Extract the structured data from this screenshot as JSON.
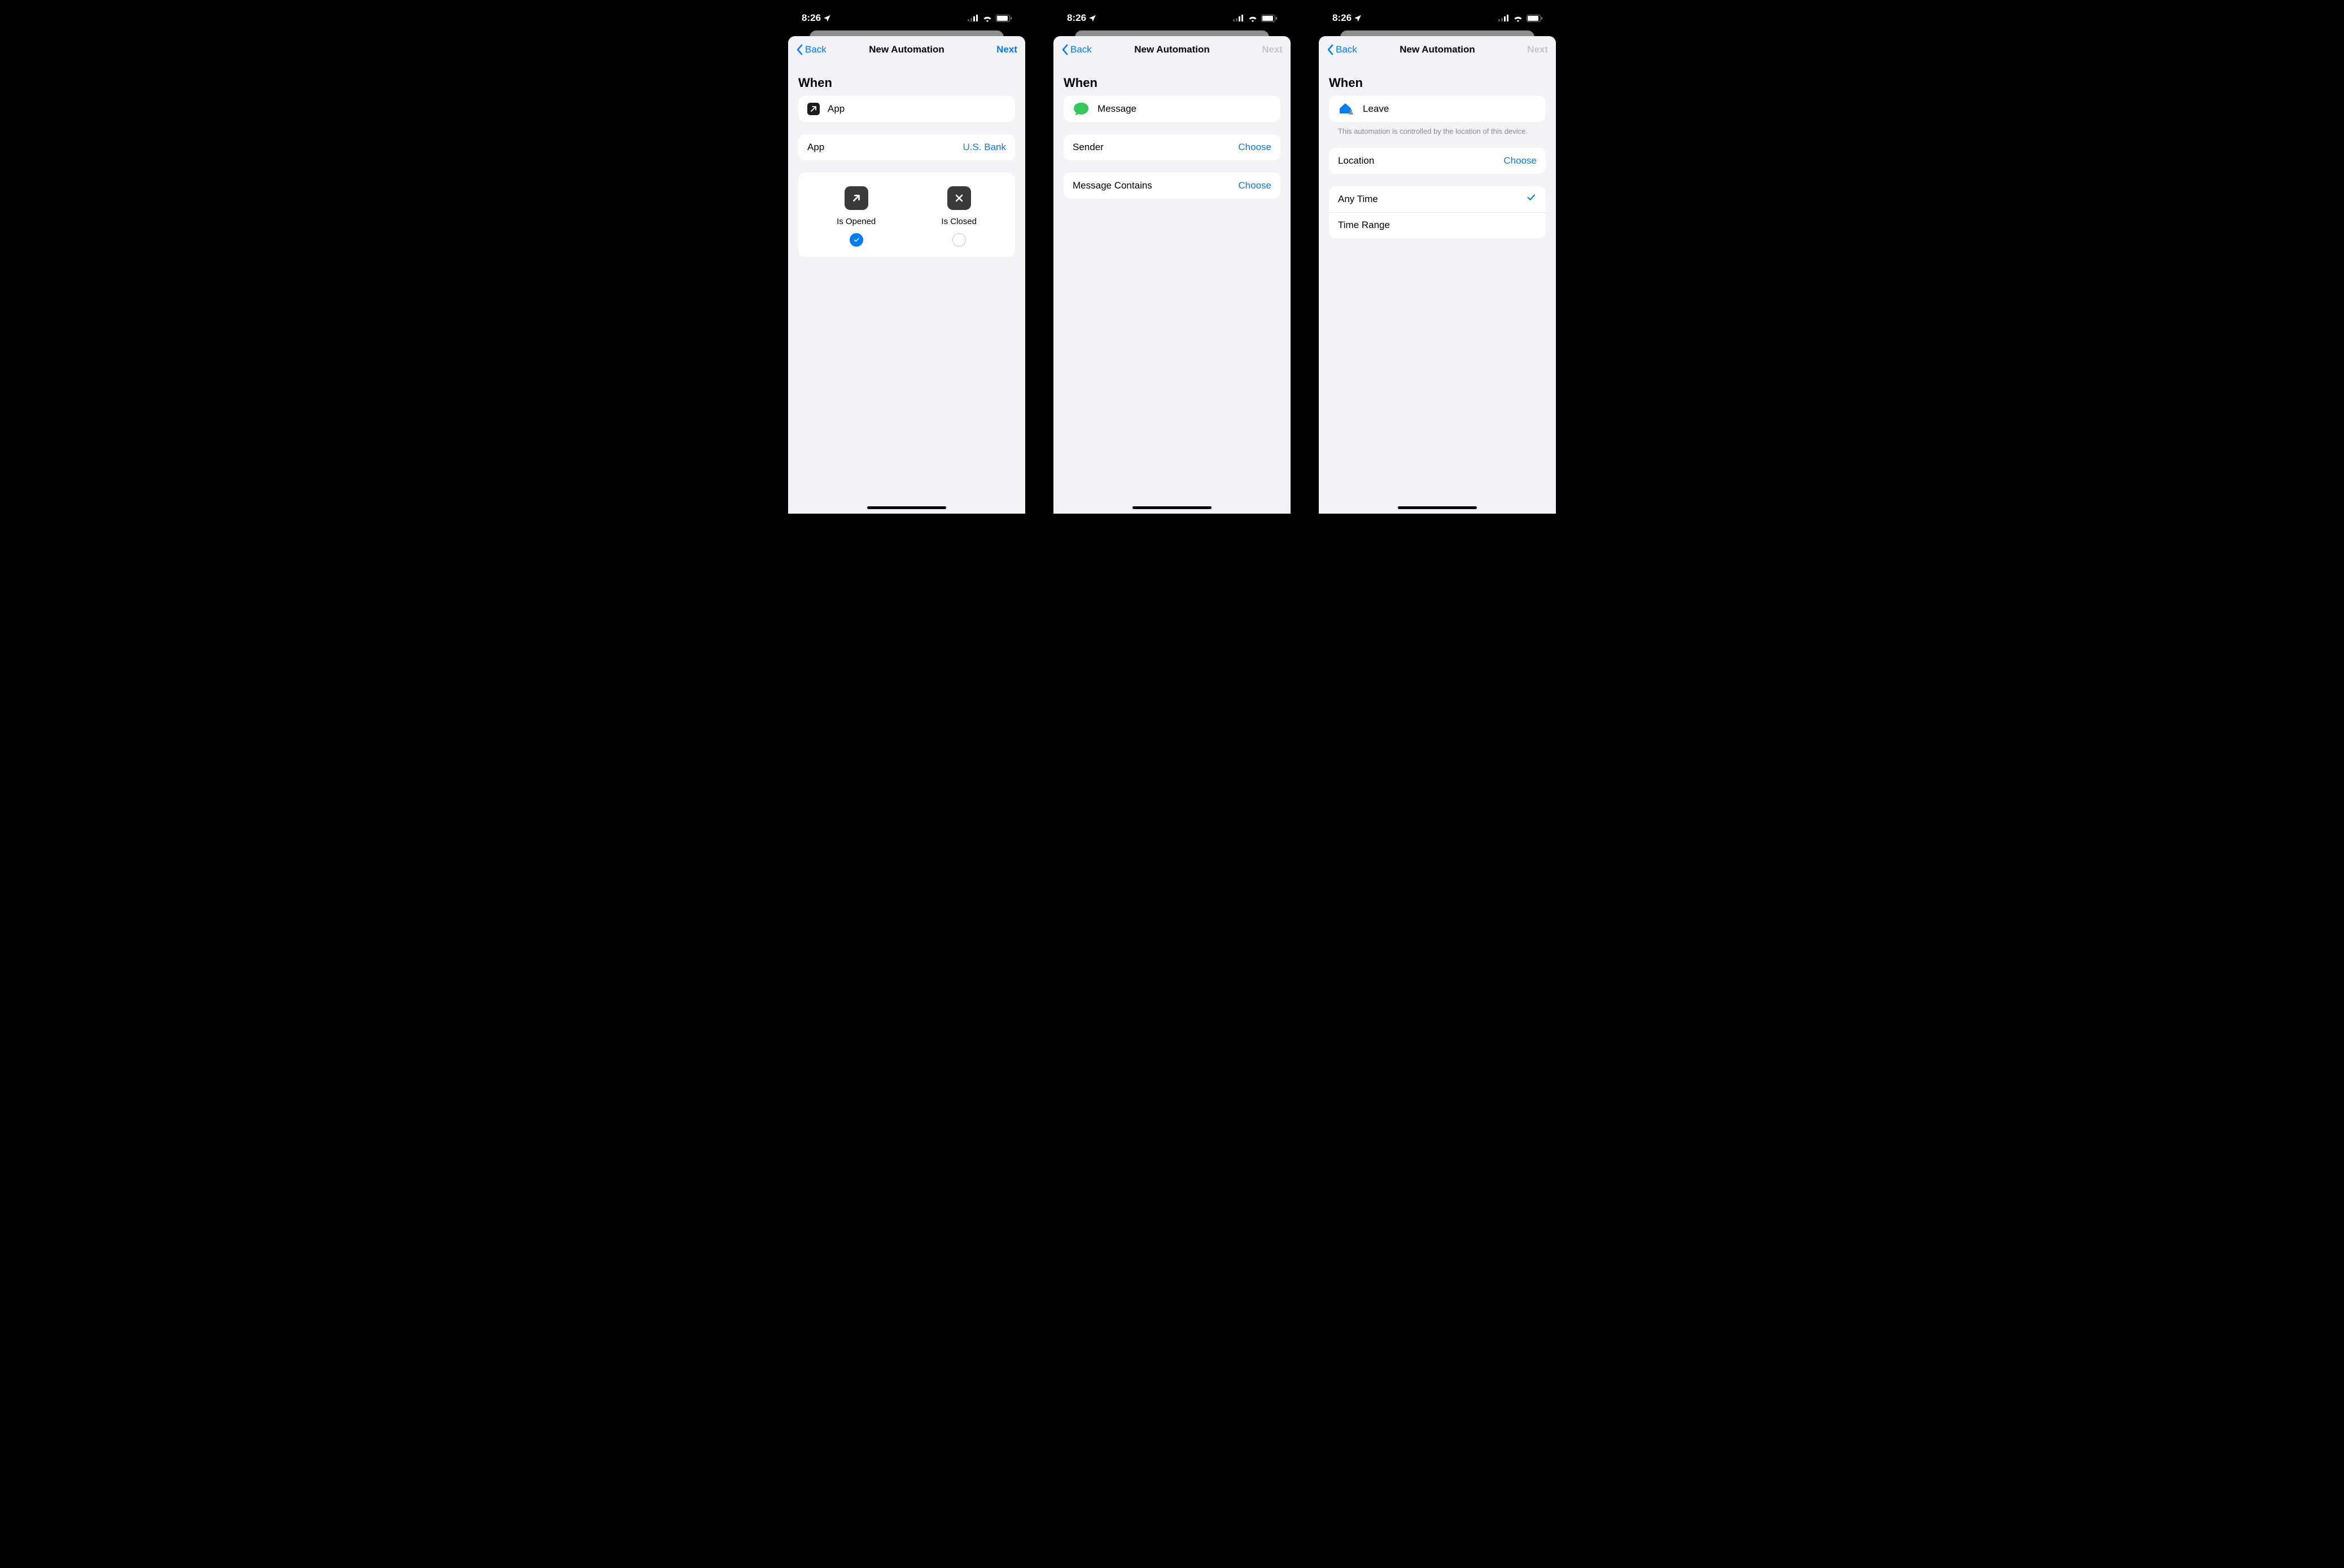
{
  "status": {
    "time": "8:26"
  },
  "nav": {
    "back": "Back",
    "title": "New Automation",
    "next": "Next"
  },
  "section_when": "When",
  "choose_label": "Choose",
  "screen1": {
    "trigger": "App",
    "app_label": "App",
    "app_value": "U.S. Bank",
    "opened": "Is Opened",
    "closed": "Is Closed"
  },
  "screen2": {
    "trigger": "Message",
    "sender": "Sender",
    "contains": "Message Contains"
  },
  "screen3": {
    "trigger": "Leave",
    "footnote": "This automation is controlled by the location of this device.",
    "location": "Location",
    "anytime": "Any Time",
    "timerange": "Time Range"
  }
}
